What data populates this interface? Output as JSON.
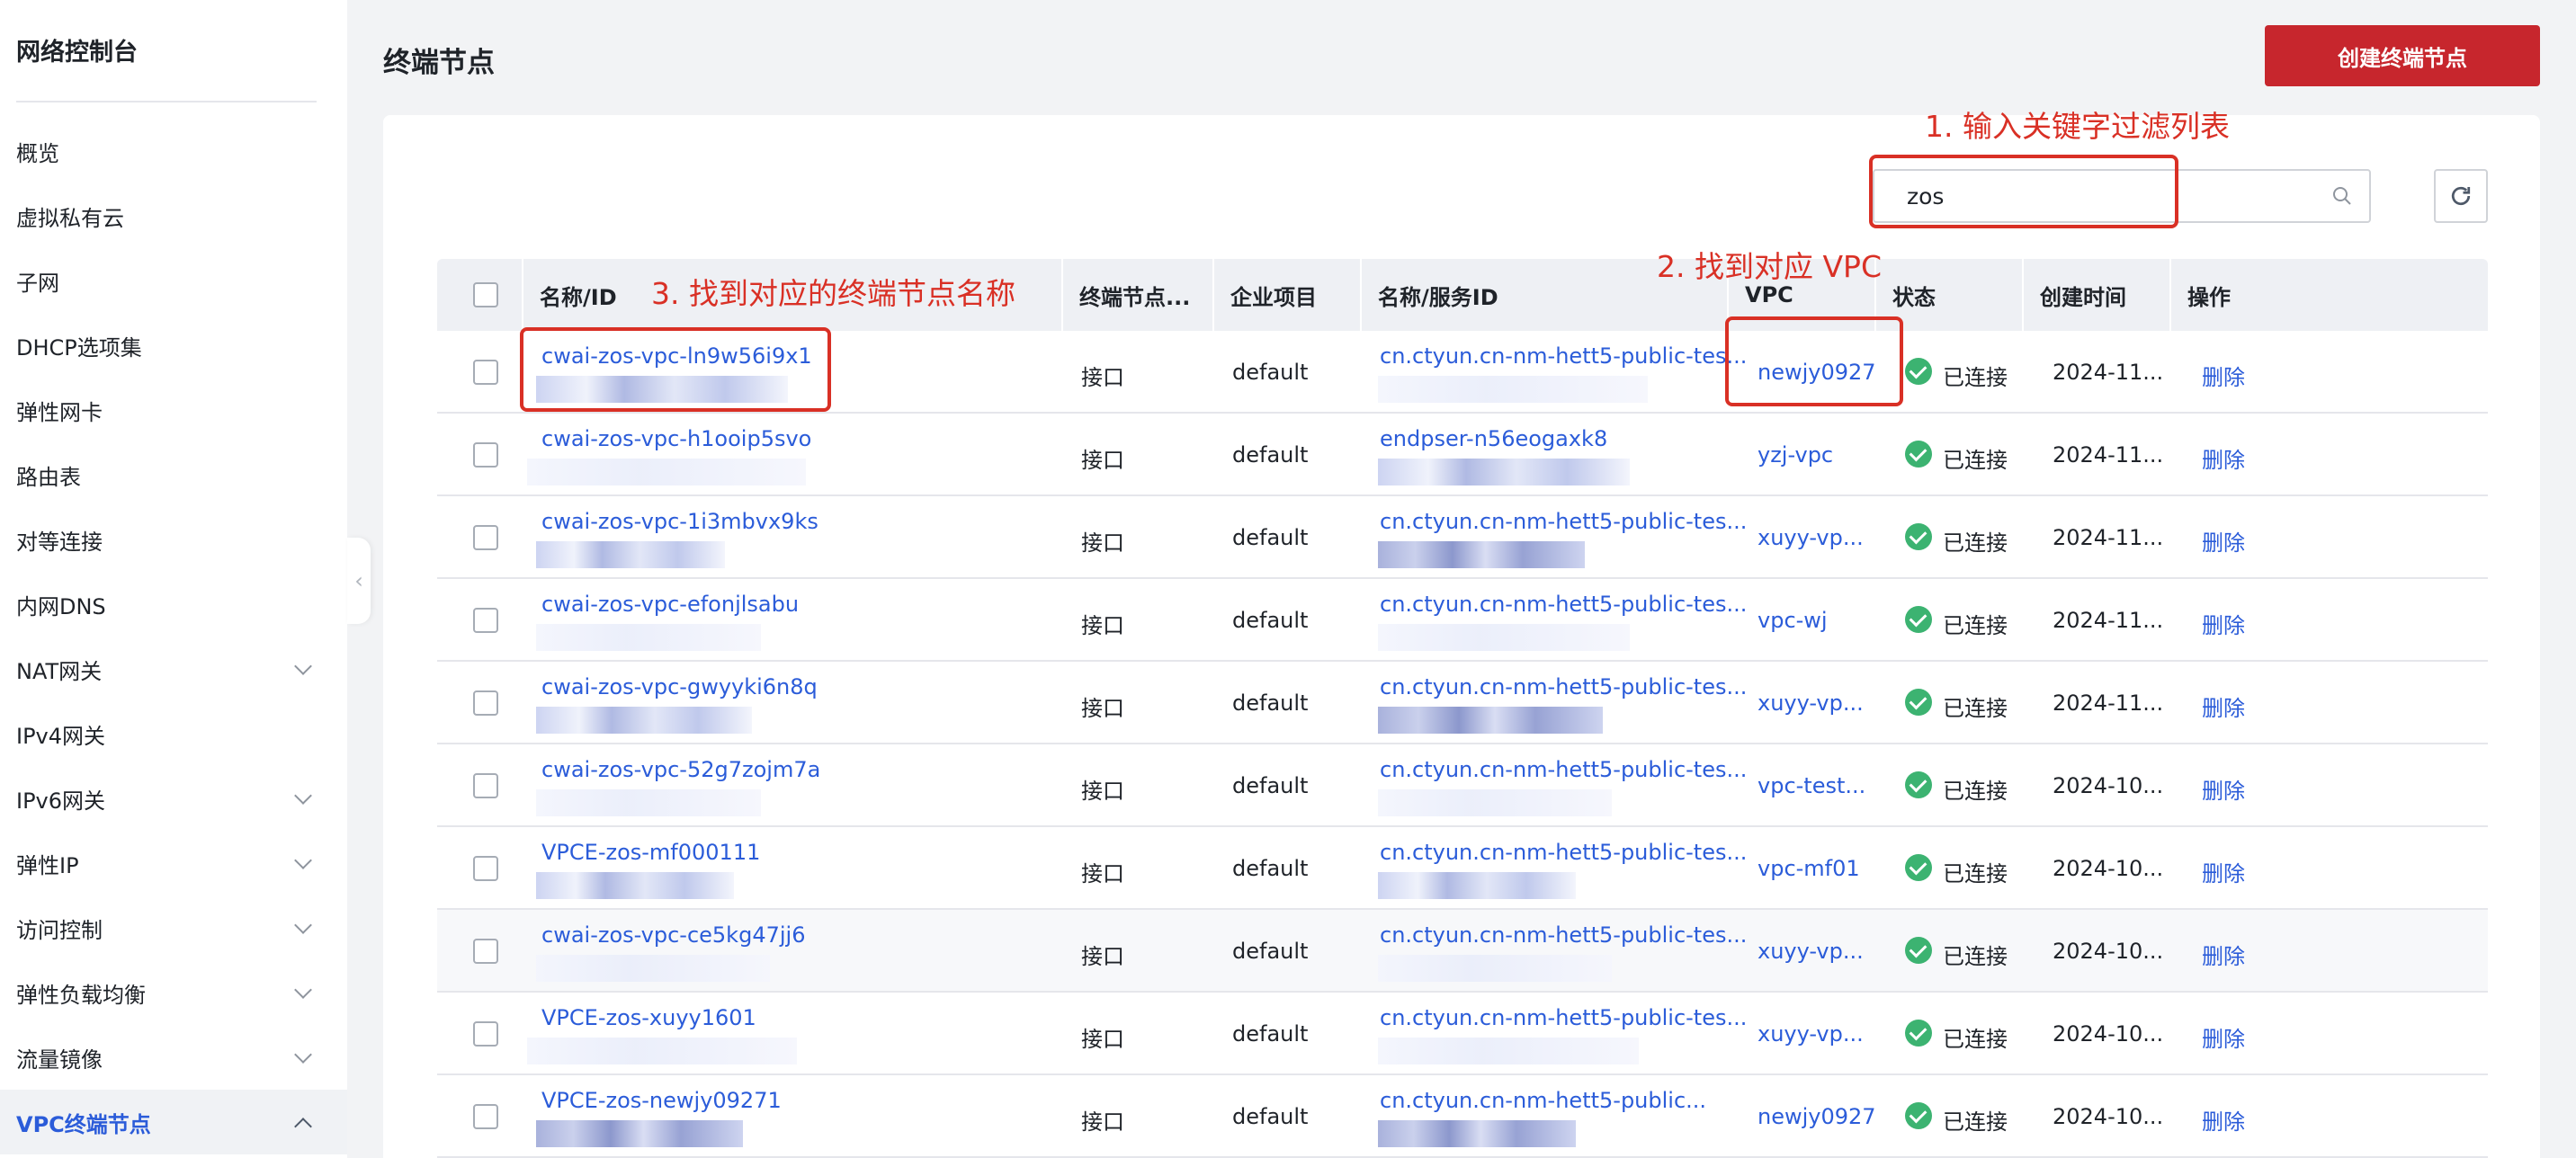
{
  "sidebar": {
    "title": "网络控制台",
    "items": [
      {
        "label": "概览"
      },
      {
        "label": "虚拟私有云"
      },
      {
        "label": "子网"
      },
      {
        "label": "DHCP选项集"
      },
      {
        "label": "弹性网卡"
      },
      {
        "label": "路由表"
      },
      {
        "label": "对等连接"
      },
      {
        "label": "内网DNS"
      },
      {
        "label": "NAT网关",
        "expandable": true
      },
      {
        "label": "IPv4网关"
      },
      {
        "label": "IPv6网关",
        "expandable": true
      },
      {
        "label": "弹性IP",
        "expandable": true
      },
      {
        "label": "访问控制",
        "expandable": true
      },
      {
        "label": "弹性负载均衡",
        "expandable": true
      },
      {
        "label": "流量镜像",
        "expandable": true
      },
      {
        "label": "VPC终端节点",
        "expandable": true,
        "active": true
      }
    ]
  },
  "header": {
    "title": "终端节点",
    "create_button": "创建终端节点"
  },
  "search": {
    "value": "zos",
    "icon": "search-icon"
  },
  "refresh": {
    "icon": "refresh-icon"
  },
  "table": {
    "columns": {
      "name": "名称/ID",
      "type": "终端节点...",
      "project": "企业项目",
      "service": "名称/服务ID",
      "vpc": "VPC",
      "status": "状态",
      "created": "创建时间",
      "action": "操作"
    },
    "rows": [
      {
        "name": "cwai-zos-vpc-ln9w56i9x1",
        "type": "接口",
        "project": "default",
        "service": "cn.ctyun.cn-nm-hett5-public-tes...",
        "vpc": "newjy0927",
        "status": "已连接",
        "created": "2024-11...",
        "action": "删除"
      },
      {
        "name": "cwai-zos-vpc-h1ooip5svo",
        "type": "接口",
        "project": "default",
        "service": "endpser-n56eogaxk8",
        "vpc": "yzj-vpc",
        "status": "已连接",
        "created": "2024-11...",
        "action": "删除"
      },
      {
        "name": "cwai-zos-vpc-1i3mbvx9ks",
        "type": "接口",
        "project": "default",
        "service": "cn.ctyun.cn-nm-hett5-public-tes...",
        "vpc": "xuyy-vp...",
        "status": "已连接",
        "created": "2024-11...",
        "action": "删除"
      },
      {
        "name": "cwai-zos-vpc-efonjlsabu",
        "type": "接口",
        "project": "default",
        "service": "cn.ctyun.cn-nm-hett5-public-tes...",
        "vpc": "vpc-wj",
        "status": "已连接",
        "created": "2024-11...",
        "action": "删除"
      },
      {
        "name": "cwai-zos-vpc-gwyyki6n8q",
        "type": "接口",
        "project": "default",
        "service": "cn.ctyun.cn-nm-hett5-public-tes...",
        "vpc": "xuyy-vp...",
        "status": "已连接",
        "created": "2024-11...",
        "action": "删除"
      },
      {
        "name": "cwai-zos-vpc-52g7zojm7a",
        "type": "接口",
        "project": "default",
        "service": "cn.ctyun.cn-nm-hett5-public-tes...",
        "vpc": "vpc-test...",
        "status": "已连接",
        "created": "2024-10...",
        "action": "删除"
      },
      {
        "name": "VPCE-zos-mf000111",
        "type": "接口",
        "project": "default",
        "service": "cn.ctyun.cn-nm-hett5-public-tes...",
        "vpc": "vpc-mf01",
        "status": "已连接",
        "created": "2024-10...",
        "action": "删除"
      },
      {
        "name": "cwai-zos-vpc-ce5kg47jj6",
        "type": "接口",
        "project": "default",
        "service": "cn.ctyun.cn-nm-hett5-public-tes...",
        "vpc": "xuyy-vp...",
        "status": "已连接",
        "created": "2024-10...",
        "action": "删除"
      },
      {
        "name": "VPCE-zos-xuyy1601",
        "type": "接口",
        "project": "default",
        "service": "cn.ctyun.cn-nm-hett5-public-tes...",
        "vpc": "xuyy-vp...",
        "status": "已连接",
        "created": "2024-10...",
        "action": "删除"
      },
      {
        "name": "VPCE-zos-newjy09271",
        "type": "接口",
        "project": "default",
        "service": "cn.ctyun.cn-nm-hett5-public...",
        "vpc": "newjy0927",
        "status": "已连接",
        "created": "2024-10...",
        "action": "删除"
      }
    ]
  },
  "annotations": {
    "step1": "1. 输入关键字过滤列表",
    "step2": "2. 找到对应 VPC",
    "step3": "3. 找到对应的终端节点名称",
    "color": "#d93025"
  },
  "colors": {
    "brand": "#c7262d",
    "link": "#2b5cd9",
    "success": "#3cb371"
  }
}
